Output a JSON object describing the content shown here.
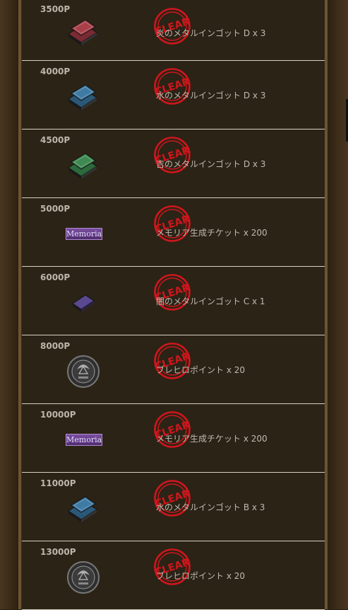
{
  "stamp_label": "CLEAR",
  "memoria_label": "Memoria",
  "colors": {
    "stamp": "#d0161c",
    "text": "#bfbab0",
    "row_bg": "#2b2316"
  },
  "rows": [
    {
      "points": "3500P",
      "icon": "red-ingot-icon",
      "reward": "炎のメタルインゴット D x 3"
    },
    {
      "points": "4000P",
      "icon": "blue-ingot-icon",
      "reward": "水のメタルインゴット D x 3"
    },
    {
      "points": "4500P",
      "icon": "green-ingot-icon",
      "reward": "吉のメタルインゴット D x 3"
    },
    {
      "points": "5000P",
      "icon": "memoria-ticket-icon",
      "reward": "メモリア生成チケット x 200"
    },
    {
      "points": "6000P",
      "icon": "purple-ingot-icon",
      "reward": "闇のメタルインゴット C x 1"
    },
    {
      "points": "8000P",
      "icon": "medal-icon",
      "reward": "ブレヒロポイント x 20"
    },
    {
      "points": "10000P",
      "icon": "memoria-ticket-icon",
      "reward": "メモリア生成チケット x 200"
    },
    {
      "points": "11000P",
      "icon": "blue-ingot-icon",
      "reward": "水のメタルインゴット B x 3"
    },
    {
      "points": "13000P",
      "icon": "medal-icon",
      "reward": "ブレヒロポイント x 20"
    }
  ]
}
